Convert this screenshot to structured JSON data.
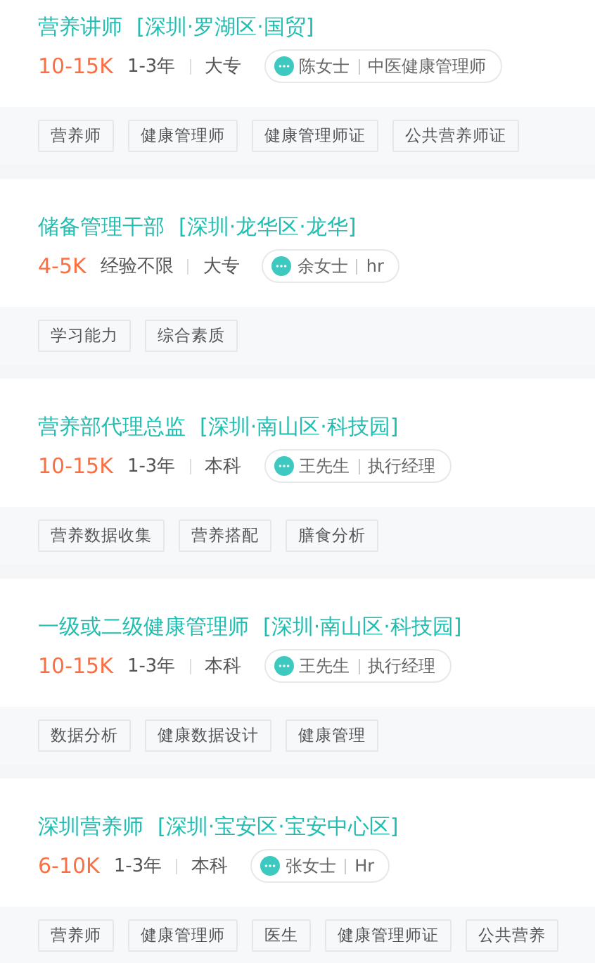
{
  "jobs": [
    {
      "title": "营养讲师",
      "location": "[深圳·罗湖区·国贸]",
      "salary": "10-15K",
      "experience": "1-3年",
      "education": "大专",
      "contact": {
        "name": "陈女士",
        "role": "中医健康管理师"
      },
      "tags": [
        "营养师",
        "健康管理师",
        "健康管理师证",
        "公共营养师证"
      ]
    },
    {
      "title": "储备管理干部",
      "location": "[深圳·龙华区·龙华]",
      "salary": "4-5K",
      "experience": "经验不限",
      "education": "大专",
      "contact": {
        "name": "余女士",
        "role": "hr"
      },
      "tags": [
        "学习能力",
        "综合素质"
      ]
    },
    {
      "title": "营养部代理总监",
      "location": "[深圳·南山区·科技园]",
      "salary": "10-15K",
      "experience": "1-3年",
      "education": "本科",
      "contact": {
        "name": "王先生",
        "role": "执行经理"
      },
      "tags": [
        "营养数据收集",
        "营养搭配",
        "膳食分析"
      ]
    },
    {
      "title": "一级或二级健康管理师",
      "location": "[深圳·南山区·科技园]",
      "salary": "10-15K",
      "experience": "1-3年",
      "education": "本科",
      "contact": {
        "name": "王先生",
        "role": "执行经理"
      },
      "tags": [
        "数据分析",
        "健康数据设计",
        "健康管理"
      ]
    },
    {
      "title": "深圳营养师",
      "location": "[深圳·宝安区·宝安中心区]",
      "salary": "6-10K",
      "experience": "1-3年",
      "education": "本科",
      "contact": {
        "name": "张女士",
        "role": "Hr"
      },
      "tags": [
        "营养师",
        "健康管理师",
        "医生",
        "健康管理师证",
        "公共营养"
      ]
    }
  ]
}
